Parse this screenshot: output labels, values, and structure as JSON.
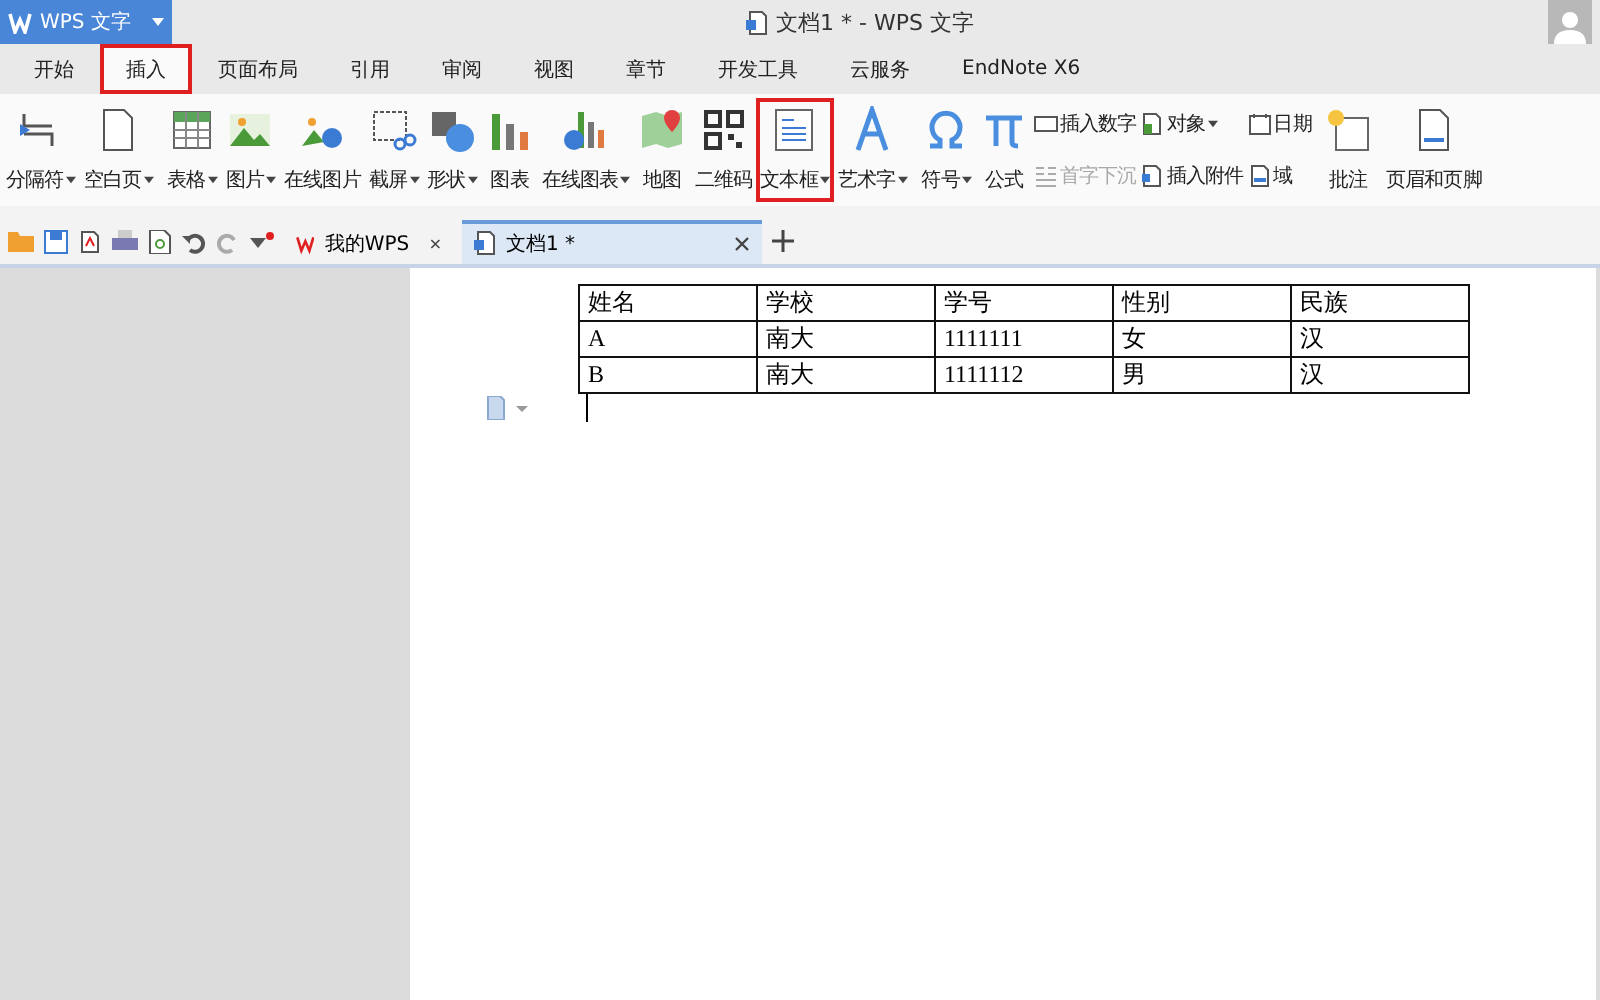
{
  "app_button": {
    "label": "WPS 文字"
  },
  "window": {
    "title": "文档1 * - WPS 文字"
  },
  "tabs": [
    {
      "label": "开始",
      "selected": false,
      "highlighted": false
    },
    {
      "label": "插入",
      "selected": true,
      "highlighted": true
    },
    {
      "label": "页面布局",
      "selected": false,
      "highlighted": false
    },
    {
      "label": "引用",
      "selected": false,
      "highlighted": false
    },
    {
      "label": "审阅",
      "selected": false,
      "highlighted": false
    },
    {
      "label": "视图",
      "selected": false,
      "highlighted": false
    },
    {
      "label": "章节",
      "selected": false,
      "highlighted": false
    },
    {
      "label": "开发工具",
      "selected": false,
      "highlighted": false
    },
    {
      "label": "云服务",
      "selected": false,
      "highlighted": false
    },
    {
      "label": "EndNote X6",
      "selected": false,
      "highlighted": false
    }
  ],
  "ribbon": {
    "groups": [
      {
        "items": [
          {
            "kind": "large",
            "label": "分隔符",
            "dropdown": true,
            "highlighted": false
          },
          {
            "kind": "large",
            "label": "空白页",
            "dropdown": true,
            "highlighted": false
          }
        ]
      },
      {
        "items": [
          {
            "kind": "large",
            "label": "表格",
            "dropdown": true,
            "highlighted": false
          },
          {
            "kind": "large",
            "label": "图片",
            "dropdown": true,
            "highlighted": false
          },
          {
            "kind": "large",
            "label": "在线图片",
            "dropdown": false,
            "highlighted": false
          },
          {
            "kind": "large",
            "label": "截屏",
            "dropdown": true,
            "highlighted": false
          },
          {
            "kind": "large",
            "label": "形状",
            "dropdown": true,
            "highlighted": false
          },
          {
            "kind": "large",
            "label": "图表",
            "dropdown": false,
            "highlighted": false
          },
          {
            "kind": "large",
            "label": "在线图表",
            "dropdown": true,
            "highlighted": false
          },
          {
            "kind": "large",
            "label": "地图",
            "dropdown": false,
            "highlighted": false
          },
          {
            "kind": "large",
            "label": "二维码",
            "dropdown": false,
            "highlighted": false
          },
          {
            "kind": "large",
            "label": "文本框",
            "dropdown": true,
            "highlighted": true
          },
          {
            "kind": "large",
            "label": "艺术字",
            "dropdown": true,
            "highlighted": false
          }
        ]
      },
      {
        "items": [
          {
            "kind": "large",
            "label": "符号",
            "dropdown": true,
            "highlighted": false
          },
          {
            "kind": "large",
            "label": "公式",
            "dropdown": false,
            "highlighted": false
          },
          {
            "kind": "stack",
            "items": [
              {
                "label": "插入数字",
                "dropdown": false,
                "disabled": false
              },
              {
                "label": "首字下沉",
                "dropdown": false,
                "disabled": true
              }
            ]
          },
          {
            "kind": "stack",
            "items": [
              {
                "label": "对象",
                "dropdown": true,
                "disabled": false
              },
              {
                "label": "插入附件",
                "dropdown": false,
                "disabled": false
              }
            ]
          },
          {
            "kind": "stack",
            "items": [
              {
                "label": "日期",
                "dropdown": false,
                "disabled": false
              },
              {
                "label": "域",
                "dropdown": false,
                "disabled": false
              }
            ]
          }
        ]
      },
      {
        "items": [
          {
            "kind": "large",
            "label": "批注",
            "dropdown": false,
            "highlighted": false
          }
        ]
      },
      {
        "items": [
          {
            "kind": "large",
            "label": "页眉和页脚",
            "dropdown": false,
            "highlighted": false
          }
        ]
      }
    ]
  },
  "doc_tabs": [
    {
      "label": "我的WPS",
      "kind": "home",
      "selected": false
    },
    {
      "label": "文档1 *",
      "kind": "doc",
      "selected": true
    }
  ],
  "table": {
    "columns": [
      "姓名",
      "学校",
      "学号",
      "性别",
      "民族"
    ],
    "rows": [
      [
        "A",
        "南大",
        "1111111",
        "女",
        "汉"
      ],
      [
        "B",
        "南大",
        "1111112",
        "男",
        "汉"
      ]
    ]
  }
}
